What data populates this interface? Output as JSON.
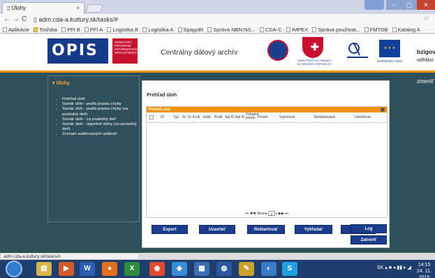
{
  "browser": {
    "tab_title": "Úlohy",
    "tab_close": "×",
    "url": "adm.cda-a.kultury.sk/tasks/#",
    "bookmarks": [
      {
        "label": "Aplikácie",
        "icon": "apps-icon"
      },
      {
        "label": "Toshiba",
        "icon": "folder-icon"
      },
      {
        "label": "PFI B",
        "icon": "page-icon"
      },
      {
        "label": "PFI A",
        "icon": "page-icon"
      },
      {
        "label": "Logistika B",
        "icon": "page-icon"
      },
      {
        "label": "Logistika A",
        "icon": "page-icon"
      },
      {
        "label": "SpagoBI",
        "icon": "spagobi-icon"
      },
      {
        "label": "Správa NBN:NS...",
        "icon": "page-icon"
      },
      {
        "label": "CDA-C",
        "icon": "page-icon"
      },
      {
        "label": "IMPEX",
        "icon": "page-icon"
      },
      {
        "label": "Správa používat...",
        "icon": "page-icon"
      },
      {
        "label": "FMTDB",
        "icon": "page-icon"
      },
      {
        "label": "Katalog A",
        "icon": "page-icon"
      }
    ]
  },
  "header": {
    "logo_text": "OPIS",
    "logo_tag": "OPERAČNÝ PROGRAM INFORMATIZÁCIA SPOLOČNOSTI",
    "title": "Centrálny dátový archív",
    "ministry_text": "MINISTERSTVO FINANCIÍ SLOVENSKEJ REPUBLIKY",
    "eu_label": "EURÓPSKA ÚNIA",
    "user": "bzigov",
    "logout": "odhlási"
  },
  "sidebar": {
    "heading": "Úlohy",
    "items": [
      "Prehľad úloh",
      "Sumár úloh - podľa popisu chyby",
      "Sumár úloh - podľa popisu chyby (za posledný deň)",
      "Sumár úloh - za posledný deň",
      "Sumár úloh - úspešné úlohy (za posledný deň)",
      "Zoznam auditovaných udalostí"
    ]
  },
  "right_link": "zmeniť hesl",
  "main": {
    "title": "Prehľad úloh",
    "grid_title": "Prehľad úloh",
    "columns": [
      "ID",
      "Typ",
      "St",
      "Vý",
      "Krok",
      "Inštit.",
      "Profil",
      "Sip ID",
      "Aip ID",
      "Vstupné písmo",
      "Predm",
      "Vytvorená",
      "Reštartovaná",
      "Ukončená"
    ],
    "pager": {
      "first": "⏮",
      "prev": "◀◀",
      "page_label": "Strana",
      "page_value": "1",
      "of_label": "z",
      "next": "▶▶",
      "last": "⏭"
    },
    "buttons": {
      "export": "Export",
      "close_task": "Uzavrieť",
      "restart": "Reštartovať",
      "search": "Vyhľadať",
      "detail": "Detail",
      "log": "Log",
      "close": "Zatvoriť"
    }
  },
  "status_bar": "adm.cda-a.kultury.sk/tasks/#",
  "taskbar": {
    "lang": "SK",
    "time": "14:15",
    "date": "24. 11. 2015"
  },
  "colors": {
    "accent": "#f19100",
    "app_bg": "#2f4f5c",
    "button": "#1b3d8c",
    "brand": "#163a8a"
  }
}
